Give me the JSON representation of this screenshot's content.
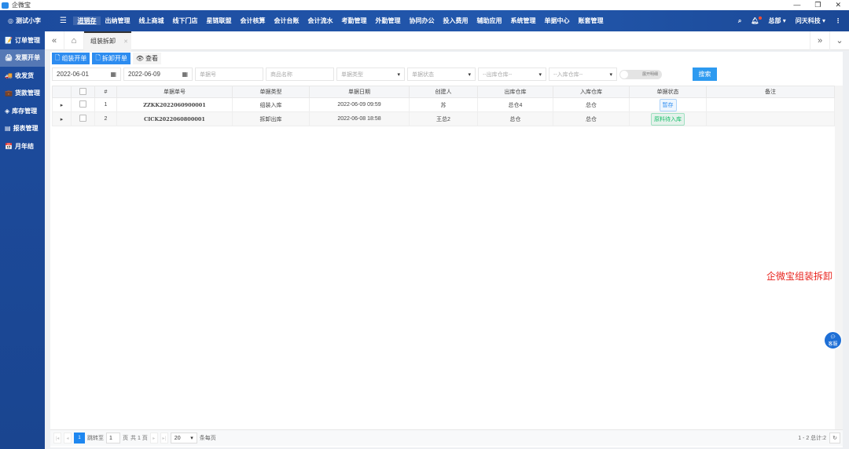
{
  "window": {
    "title": "企微宝",
    "controls": [
      "—",
      "❐",
      "✕"
    ]
  },
  "topnav": {
    "user": "测试小李",
    "items": [
      "进销存",
      "出纳管理",
      "线上商城",
      "线下门店",
      "星链联盟",
      "会计核算",
      "会计台账",
      "会计流水",
      "考勤管理",
      "外勤管理",
      "协同办公",
      "投入费用",
      "辅助应用",
      "系统管理",
      "单据中心",
      "账套管理"
    ],
    "active": 0,
    "org": "总部",
    "company": "问天科技"
  },
  "sidebar": {
    "items": [
      {
        "label": "订单管理",
        "icon": "📝"
      },
      {
        "label": "发票开单",
        "icon": "🖨"
      },
      {
        "label": "收发货",
        "icon": "🚚"
      },
      {
        "label": "货款管理",
        "icon": "💼"
      },
      {
        "label": "库存管理",
        "icon": "◈"
      },
      {
        "label": "报表管理",
        "icon": "▤"
      },
      {
        "label": "月年结",
        "icon": "📅"
      }
    ],
    "active": 1
  },
  "tabs": {
    "items": [
      {
        "label": "组装拆卸"
      }
    ]
  },
  "toolbar": {
    "assemble": "组装开单",
    "disassemble": "拆卸开单",
    "view": "查看"
  },
  "filters": {
    "date_from": "2022-06-01",
    "date_to": "2022-06-09",
    "doc_no": "单据号",
    "product": "商品名称",
    "doc_type": "单据类型",
    "doc_status": "单据状态",
    "out_wh": "--出库仓库--",
    "in_wh": "--入库仓库--",
    "toggle": "展开明细",
    "search": "搜索"
  },
  "table": {
    "headers": [
      "#",
      "单据单号",
      "单据类型",
      "单据日期",
      "创建人",
      "出库仓库",
      "入库仓库",
      "单据状态",
      "备注"
    ],
    "rows": [
      {
        "idx": "1",
        "code": "ZZKK2022060900001",
        "type": "组装入库",
        "date": "2022-06-09 09:59",
        "creator": "苏",
        "out": "总仓4",
        "in": "总仓",
        "status": "暂存",
        "status_color": "#2d8cf0",
        "remark": ""
      },
      {
        "idx": "2",
        "code": "CICK2022060800001",
        "type": "拆卸出库",
        "date": "2022-06-08 18:58",
        "creator": "王总2",
        "out": "总仓",
        "in": "总仓",
        "status": "原料待入库",
        "status_color": "#19be6b",
        "remark": ""
      }
    ]
  },
  "pager": {
    "current": "1",
    "goto_label": "跳转至",
    "goto_value": "1",
    "page_unit": "页",
    "total_pages": "共 1 页",
    "page_size": "20",
    "per_page": "条每页",
    "summary": "1 - 2 总计:2"
  },
  "watermark": "企微宝组装拆卸",
  "kefu": "客服"
}
